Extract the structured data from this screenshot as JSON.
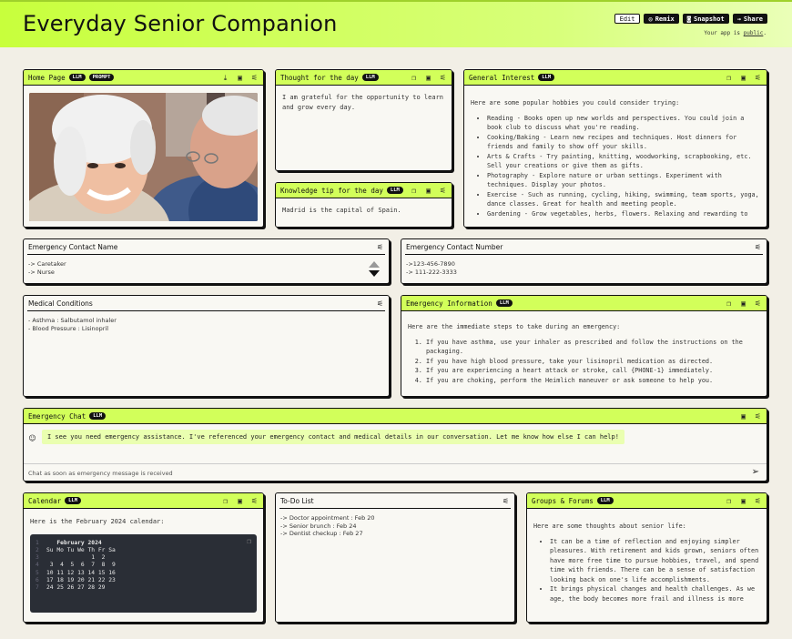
{
  "app": {
    "title": "Everyday Senior Companion",
    "edit_label": "Edit",
    "remix_label": "Remix",
    "snapshot_label": "Snapshot",
    "share_label": "Share",
    "public_prefix": "Your app is",
    "public_word": "public",
    "public_suffix": ".",
    "accent": "#d2ff5a"
  },
  "home": {
    "title": "Home Page",
    "badge1": "LLM",
    "badge2": "PROMPT"
  },
  "thought": {
    "title": "Thought for the day",
    "badge": "LLM",
    "text": "I am grateful for the opportunity to learn and grow every day."
  },
  "knowledge": {
    "title": "Knowledge tip for the day",
    "badge": "LLM",
    "text": "Madrid is the capital of Spain."
  },
  "general": {
    "title": "General Interest",
    "badge": "LLM",
    "intro": "Here are some popular hobbies you could consider trying:",
    "items": [
      "Reading - Books open up new worlds and perspectives. You could join a book club to discuss what you're reading.",
      "Cooking/Baking - Learn new recipes and techniques. Host dinners for friends and family to show off your skills.",
      "Arts & Crafts - Try painting, knitting, woodworking, scrapbooking, etc. Sell your creations or give them as gifts.",
      "Photography - Explore nature or urban settings. Experiment with techniques. Display your photos.",
      "Exercise - Such as running, cycling, hiking, swimming, team sports, yoga, dance classes. Great for health and meeting people.",
      "Gardening - Grow vegetables, herbs, flowers. Relaxing and rewarding to"
    ]
  },
  "contact_name": {
    "title": "Emergency Contact Name",
    "lines": [
      "-> Caretaker",
      "-> Nurse"
    ]
  },
  "contact_number": {
    "title": "Emergency Contact Number",
    "lines": [
      "->123-456-7890",
      "-> 111-222-3333"
    ]
  },
  "medical": {
    "title": "Medical Conditions",
    "lines": [
      "- Asthma : Salbutamol inhaler",
      "- Blood Pressure : Lisinopril"
    ]
  },
  "emergency_info": {
    "title": "Emergency Information",
    "badge": "LLM",
    "intro": "Here are the immediate steps to take during an emergency:",
    "steps": [
      "If you have asthma, use your inhaler as prescribed and follow the instructions on the packaging.",
      "If you have high blood pressure, take your lisinopril medication as directed.",
      "If you are experiencing a heart attack or stroke, call {PHONE-1} immediately.",
      "If you are choking, perform the Heimlich maneuver or ask someone to help you."
    ]
  },
  "chat": {
    "title": "Emergency Chat",
    "badge": "LLM",
    "message": "I see you need emergency assistance. I've referenced your emergency contact and medical details in our conversation. Let me know how else I can help!",
    "placeholder": "Chat as soon as emergency message is received"
  },
  "calendar": {
    "title": "Calendar",
    "badge": "LLM",
    "intro": "Here is the February 2024 calendar:",
    "lines": [
      {
        "n": "1",
        "t": "   February 2024"
      },
      {
        "n": "2",
        "t": "Su Mo Tu We Th Fr Sa"
      },
      {
        "n": "3",
        "t": "             1  2"
      },
      {
        "n": "4",
        "t": " 3  4  5  6  7  8  9"
      },
      {
        "n": "5",
        "t": "10 11 12 13 14 15 16"
      },
      {
        "n": "6",
        "t": "17 18 19 20 21 22 23"
      },
      {
        "n": "7",
        "t": "24 25 26 27 28 29"
      }
    ]
  },
  "todo": {
    "title": "To-Do List",
    "lines": [
      "-> Doctor appointment : Feb 20",
      "-> Senior brunch : Feb 24",
      "-> Dentist checkup : Feb 27"
    ]
  },
  "groups": {
    "title": "Groups & Forums",
    "badge": "LLM",
    "intro": "Here are some thoughts about senior life:",
    "items": [
      "It can be a time of reflection and enjoying simpler pleasures. With retirement and kids grown, seniors often have more free time to pursue hobbies, travel, and spend time with friends. There can be a sense of satisfaction looking back on one's life accomplishments.",
      "It brings physical changes and health challenges. As we age, the body becomes more frail and illness is more"
    ]
  }
}
